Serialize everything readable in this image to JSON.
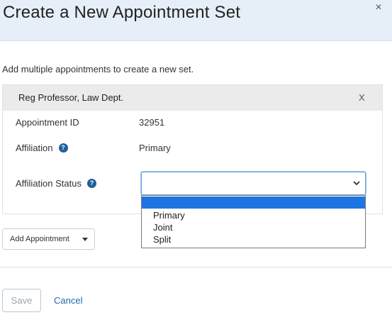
{
  "dialog": {
    "title": "Create a New Appointment Set",
    "close_label": "×"
  },
  "intro_text": "Add multiple appointments to create a new set.",
  "appointment": {
    "title": "Reg Professor, Law Dept.",
    "remove_label": "X",
    "fields": {
      "appointment_id_label": "Appointment ID",
      "appointment_id_value": "32951",
      "affiliation_label": "Affiliation",
      "affiliation_value": "Primary",
      "affiliation_status_label": "Affiliation Status",
      "affiliation_status_value": ""
    },
    "help_glyph": "?"
  },
  "status_options": [
    "",
    "Primary",
    "Joint",
    "Split"
  ],
  "add_button": {
    "label": "Add Appointment"
  },
  "footer": {
    "save_label": "Save",
    "cancel_label": "Cancel"
  },
  "colors": {
    "header_bg": "#e6eff8",
    "accent": "#1e6bb0",
    "selected_option": "#1e74e0",
    "help_icon": "#1f5f9c"
  }
}
